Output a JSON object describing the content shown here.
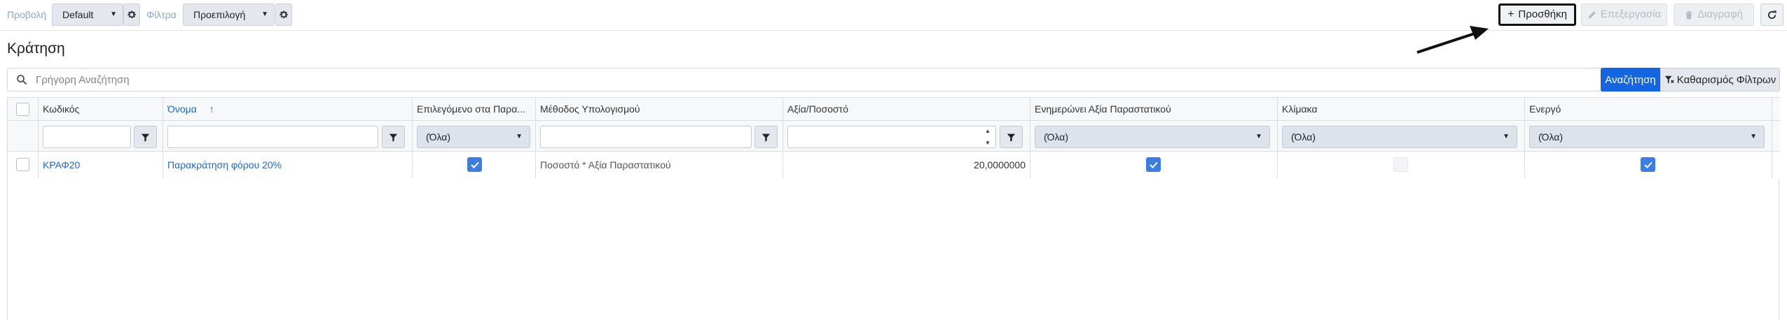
{
  "toolbar": {
    "view_label": "Προβολή",
    "view_value": "Default",
    "filters_label": "Φίλτρα",
    "filters_value": "Προεπιλογή",
    "add_label": "Προσθήκη",
    "edit_label": "Επεξεργασία",
    "delete_label": "Διαγραφή"
  },
  "page": {
    "title": "Κράτηση"
  },
  "search": {
    "placeholder": "Γρήγορη Αναζήτηση",
    "search_button": "Αναζήτηση",
    "clear_button": "Καθαρισμός Φίλτρων"
  },
  "table": {
    "columns": [
      "Κωδικός",
      "Όνομα",
      "Επιλεγόμενο στα Παρα...",
      "Μέθοδος Υπολογισμού",
      "Αξία/Ποσοστό",
      "Ενημερώνει Αξία Παραστατικού",
      "Κλίμακα",
      "Ενεργό"
    ],
    "sort_indicator": "↑",
    "filter_all": "(Όλα)",
    "rows": [
      {
        "code": "ΚΡΑΦ20",
        "name": "Παρακράτηση φόρου 20%",
        "selectable": true,
        "method": "Ποσοστό * Αξία Παραστατικού",
        "value": "20,0000000",
        "updates_value": true,
        "scale": false,
        "active": true
      }
    ]
  },
  "colors": {
    "accent": "#1565e0",
    "link": "#1e66d0",
    "checkbox_on": "#3d7de0"
  }
}
